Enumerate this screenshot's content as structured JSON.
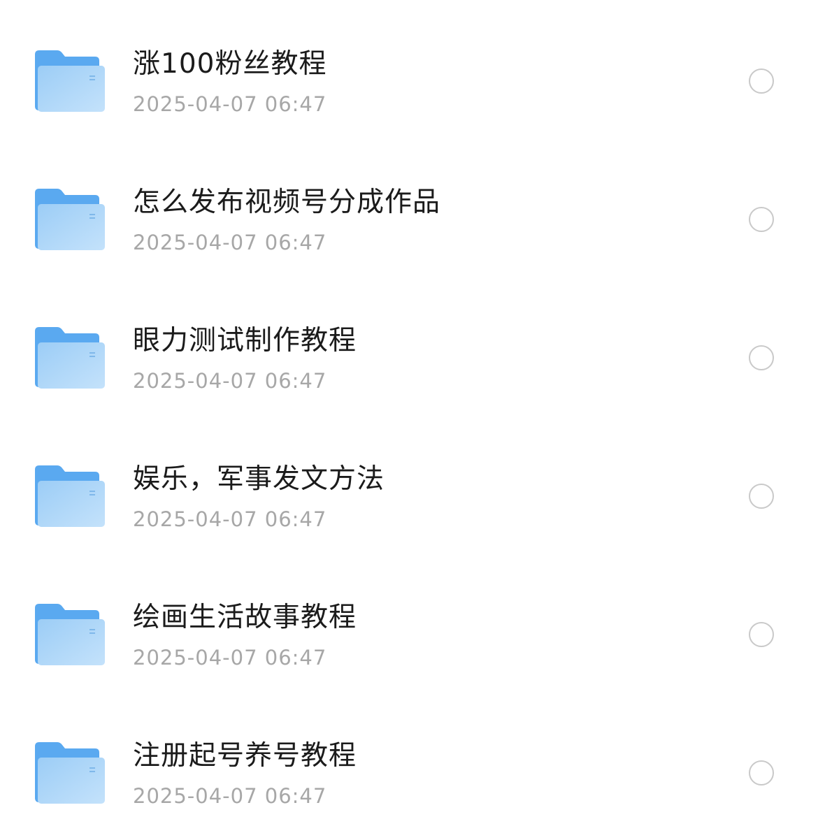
{
  "files": [
    {
      "name": "涨100粉丝教程",
      "date": "2025-04-07 06:47",
      "icon": "folder-icon"
    },
    {
      "name": "怎么发布视频号分成作品",
      "date": "2025-04-07 06:47",
      "icon": "folder-icon"
    },
    {
      "name": "眼力测试制作教程",
      "date": "2025-04-07 06:47",
      "icon": "folder-icon"
    },
    {
      "name": "娱乐，军事发文方法",
      "date": "2025-04-07 06:47",
      "icon": "folder-icon"
    },
    {
      "name": "绘画生活故事教程",
      "date": "2025-04-07 06:47",
      "icon": "folder-icon"
    },
    {
      "name": "注册起号养号教程",
      "date": "2025-04-07 06:47",
      "icon": "folder-icon"
    }
  ],
  "colors": {
    "folder_back": "#5aa9f0",
    "folder_front_top": "#9ccdf6",
    "folder_front_bottom": "#c4e2fb",
    "title_text": "#1b1b1b",
    "date_text": "#a7a7a7",
    "radio_border": "#c9c9c9"
  }
}
